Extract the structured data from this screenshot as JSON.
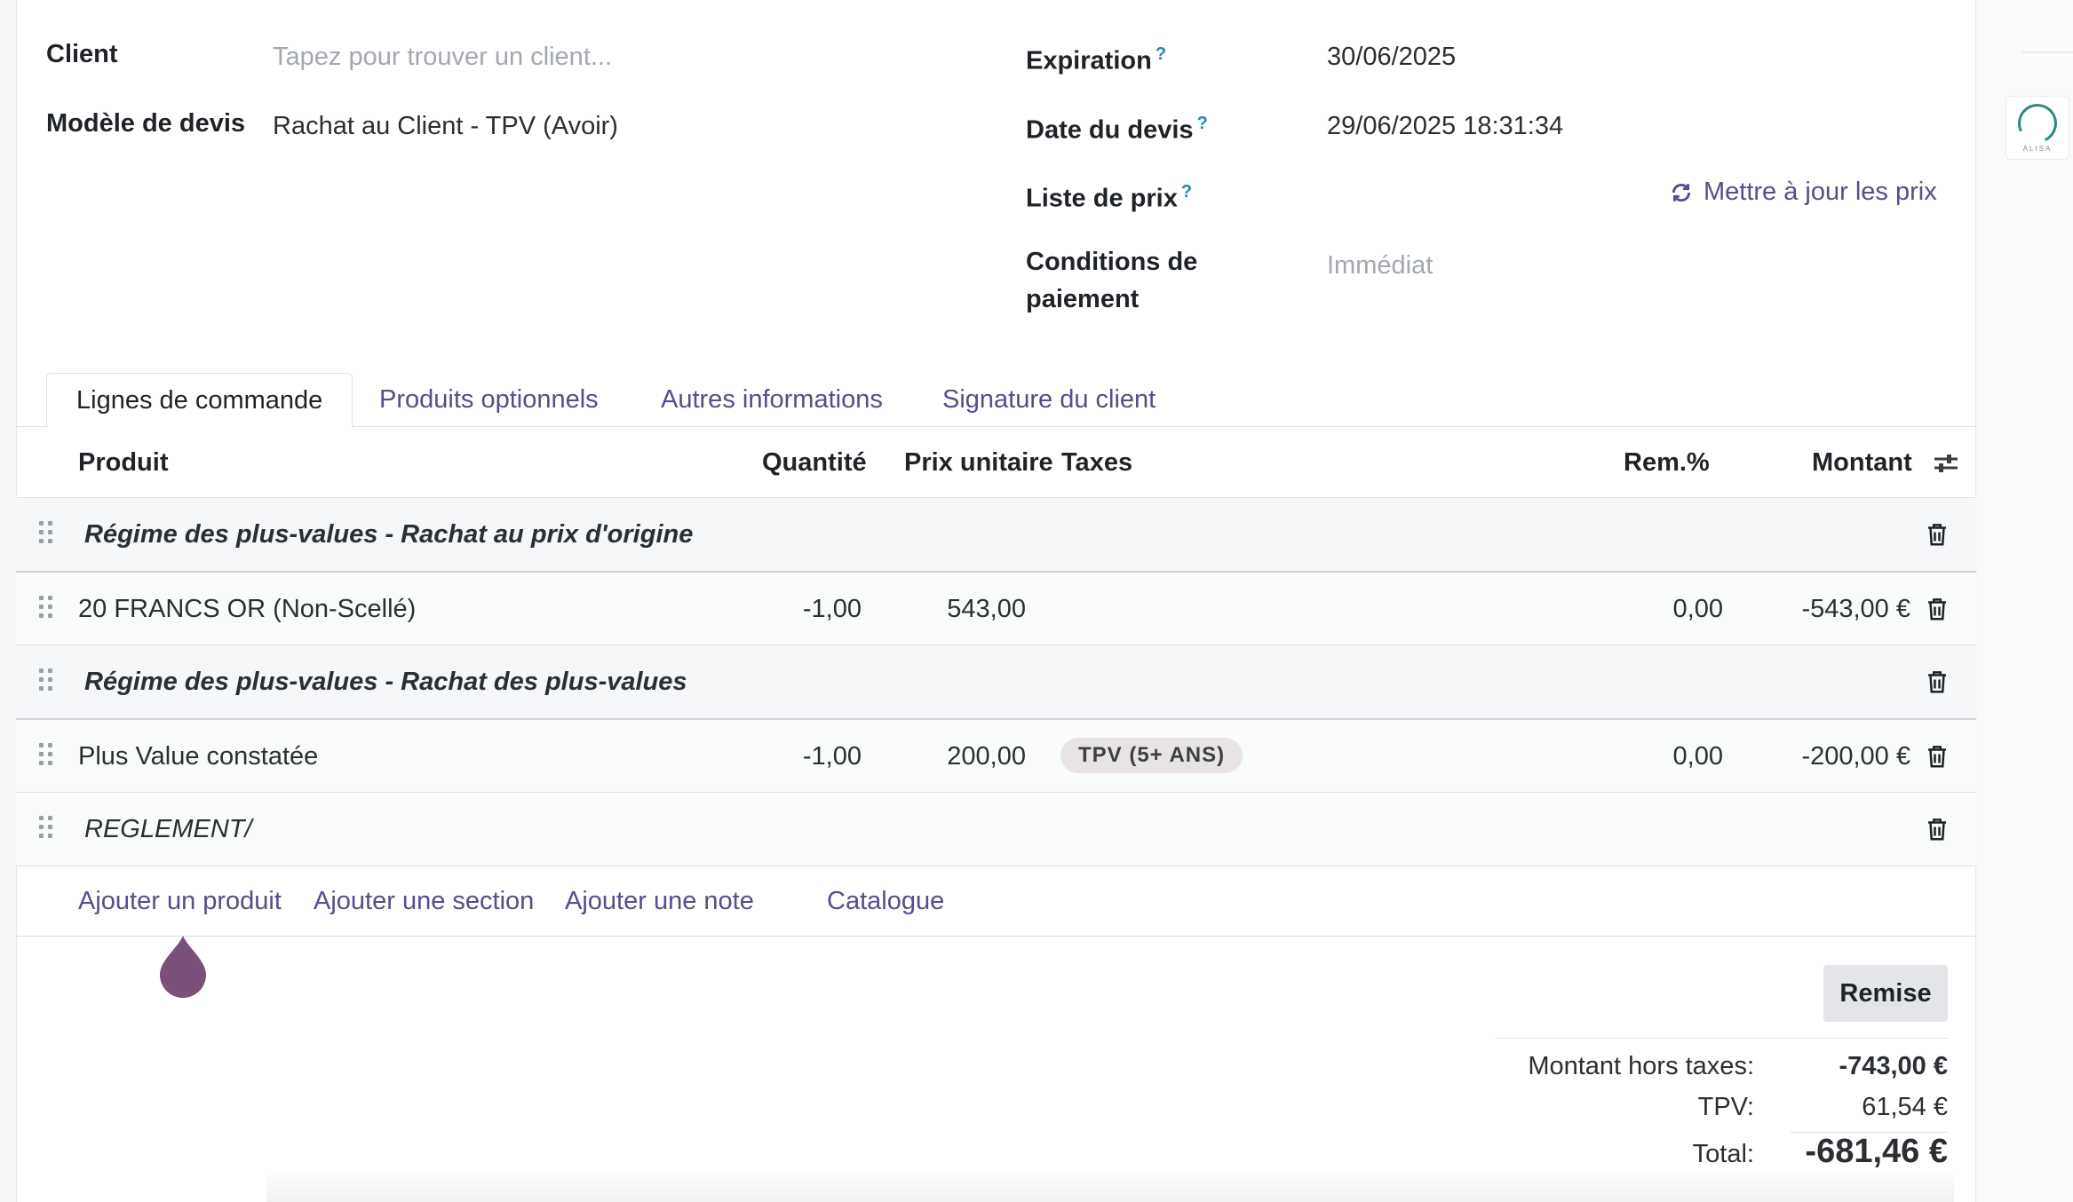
{
  "form": {
    "client_label": "Client",
    "client_placeholder": "Tapez pour trouver un client...",
    "template_label": "Modèle de devis",
    "template_value": "Rachat au Client - TPV (Avoir)",
    "expiration_label": "Expiration",
    "expiration_value": "30/06/2025",
    "quote_date_label": "Date du devis",
    "quote_date_value": "29/06/2025 18:31:34",
    "pricelist_label": "Liste de prix",
    "update_prices_label": "Mettre à jour les prix",
    "payment_terms_label_1": "Conditions de",
    "payment_terms_label_2": "paiement",
    "payment_terms_placeholder": "Immédiat",
    "help_mark": "?"
  },
  "tabs": [
    {
      "label": "Lignes de commande",
      "active": true
    },
    {
      "label": "Produits optionnels",
      "active": false
    },
    {
      "label": "Autres informations",
      "active": false
    },
    {
      "label": "Signature du client",
      "active": false
    }
  ],
  "table": {
    "headers": {
      "product": "Produit",
      "quantity": "Quantité",
      "unit_price": "Prix unitaire",
      "taxes": "Taxes",
      "discount": "Rem.%",
      "amount": "Montant"
    },
    "rows": [
      {
        "type": "section",
        "label": "Régime des plus-values - Rachat au prix d'origine"
      },
      {
        "type": "line",
        "product": "20 FRANCS OR (Non-Scellé)",
        "quantity": "-1,00",
        "unit_price": "543,00",
        "tax": "",
        "discount": "0,00",
        "amount": "-543,00 €"
      },
      {
        "type": "section",
        "label": "Régime des plus-values - Rachat des plus-values"
      },
      {
        "type": "line",
        "product": "Plus Value constatée",
        "quantity": "-1,00",
        "unit_price": "200,00",
        "tax": "TPV (5+ ANS)",
        "discount": "0,00",
        "amount": "-200,00 €"
      },
      {
        "type": "note",
        "label": "REGLEMENT/"
      }
    ],
    "add_product": "Ajouter un produit",
    "add_section": "Ajouter une section",
    "add_note": "Ajouter une note",
    "catalog": "Catalogue"
  },
  "summary": {
    "discount_button": "Remise",
    "untaxed_label": "Montant hors taxes:",
    "untaxed_value": "-743,00 €",
    "tax_label": "TPV:",
    "tax_value": "61,54 €",
    "total_label": "Total:",
    "total_value": "-681,46 €"
  },
  "colors": {
    "accent": "#5a4b8c",
    "help": "#1a8ab5",
    "cursor_drop": "#7a4f78"
  },
  "icons": {
    "refresh": "refresh-icon",
    "trash": "trash-icon",
    "drag": "drag-handle-icon",
    "column_settings": "sliders-icon"
  }
}
